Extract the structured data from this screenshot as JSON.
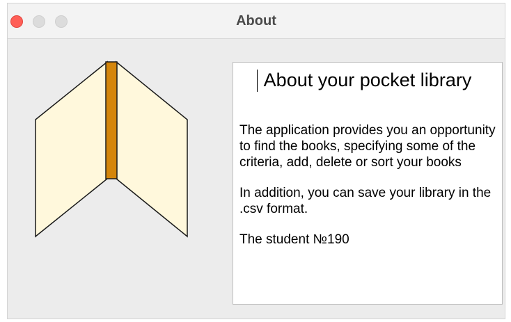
{
  "window": {
    "title": "About"
  },
  "colors": {
    "close_button": "#ff5f57",
    "page_fill": "#fff8dc",
    "spine": "#d4860b",
    "window_bg": "#ececec"
  },
  "illustration": {
    "icon": "open-book-icon"
  },
  "about": {
    "heading": "About your pocket library",
    "paragraph_1": "The application provides you an opportunity to find the books, specifying some of the criteria, add, delete or sort your books",
    "paragraph_2": "In addition, you can save your library in the .csv format.",
    "paragraph_3": "The student №190"
  }
}
